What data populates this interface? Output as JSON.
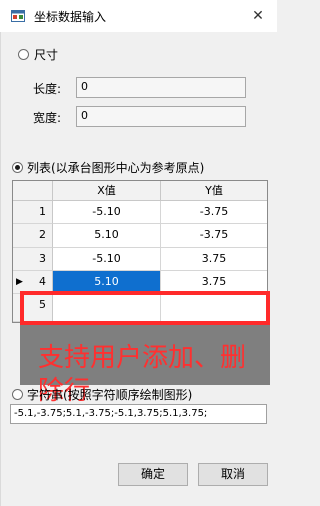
{
  "window": {
    "title": "坐标数据输入",
    "close_glyph": "✕"
  },
  "size_section": {
    "radio_label": "尺寸",
    "length_label": "长度:",
    "length_value": "0",
    "width_label": "宽度:",
    "width_value": "0"
  },
  "list_section": {
    "radio_label": "列表(以承台图形中心为参考原点)",
    "columns": [
      "X值",
      "Y值"
    ],
    "rows": [
      {
        "num": "1",
        "x": "-5.10",
        "y": "-3.75"
      },
      {
        "num": "2",
        "x": "5.10",
        "y": "-3.75"
      },
      {
        "num": "3",
        "x": "-5.10",
        "y": "3.75"
      },
      {
        "num": "4",
        "x": "5.10",
        "y": "3.75"
      },
      {
        "num": "5",
        "x": "",
        "y": ""
      }
    ],
    "current_row_marker": "▶"
  },
  "annotation": {
    "line1": "支持用户添加、删",
    "line2": "除行"
  },
  "string_section": {
    "radio_label": "字符串(按照字符顺序绘制图形)",
    "value": "-5.1,-3.75;5.1,-3.75;-5.1,3.75;5.1,3.75;"
  },
  "buttons": {
    "ok": "确定",
    "cancel": "取消"
  },
  "colors": {
    "selected_cell": "#0f6fcf",
    "annotation": "#ff2a2a"
  }
}
